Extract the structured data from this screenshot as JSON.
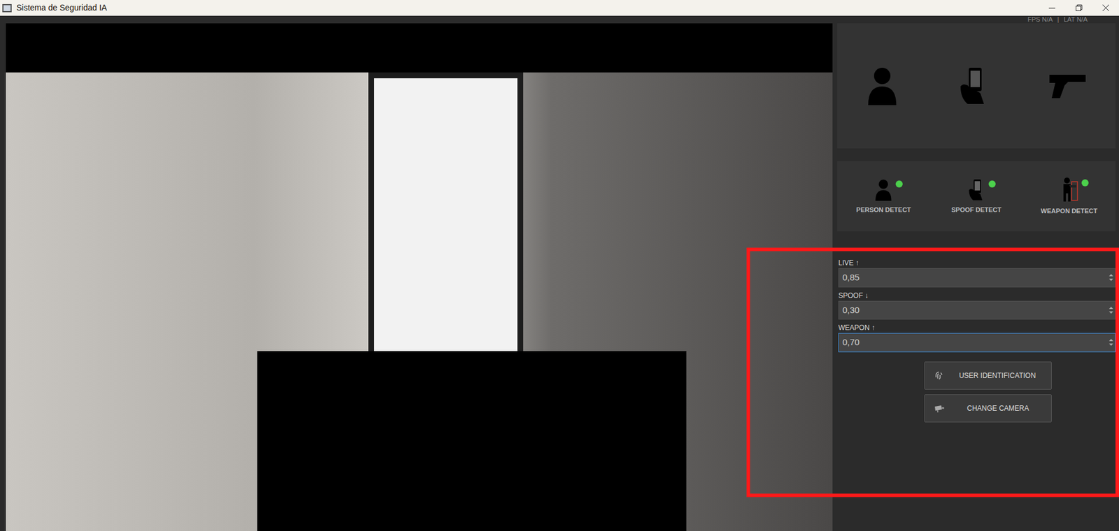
{
  "window": {
    "title": "Sistema de Seguridad IA"
  },
  "status": {
    "fps": "FPS N/A",
    "separator": "|",
    "latency": "LAT N/A"
  },
  "indicators": [
    {
      "label": "PERSON DETECT",
      "active": true
    },
    {
      "label": "SPOOF DETECT",
      "active": true
    },
    {
      "label": "WEAPON DETECT",
      "active": true
    }
  ],
  "thresholds": [
    {
      "label": "LIVE ↑",
      "value": "0,85",
      "focused": false
    },
    {
      "label": "SPOOF ↓",
      "value": "0,30",
      "focused": false
    },
    {
      "label": "WEAPON ↑",
      "value": "0,70",
      "focused": true
    }
  ],
  "buttons": [
    {
      "label": "USER IDENTIFICATION",
      "kind": "identify"
    },
    {
      "label": "CHANGE CAMERA",
      "kind": "camera"
    }
  ]
}
